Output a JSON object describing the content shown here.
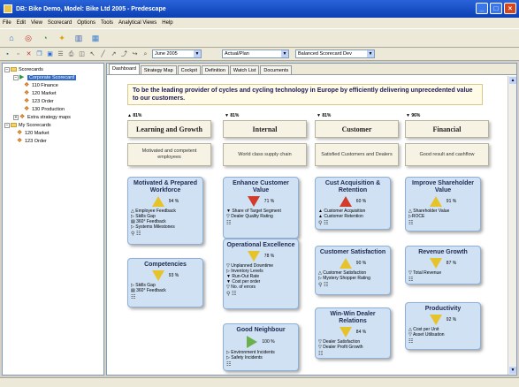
{
  "window": {
    "title": "DB: Bike Demo, Model: Bike Ltd 2005 - Predescape"
  },
  "menu": [
    "File",
    "Edit",
    "View",
    "Scorecard",
    "Options",
    "Tools",
    "Analytical Views",
    "Help"
  ],
  "toolbar2": {
    "period": "June 2005",
    "view": "Actual/Plan",
    "scorecard": "Balanced Scorecard Dev"
  },
  "tree": [
    {
      "label": "Scorecards",
      "level": 0,
      "type": "folder",
      "exp": "−"
    },
    {
      "label": "Corporate Scorecard",
      "level": 1,
      "type": "scorecard",
      "exp": "−",
      "selected": true
    },
    {
      "label": "110 Finance",
      "level": 2,
      "type": "scorecard"
    },
    {
      "label": "120 Market",
      "level": 2,
      "type": "scorecard"
    },
    {
      "label": "123 Order",
      "level": 2,
      "type": "scorecard"
    },
    {
      "label": "130 Production",
      "level": 2,
      "type": "scorecard"
    },
    {
      "label": "Extra strategy maps",
      "level": 1,
      "type": "scorecard",
      "exp": "+"
    },
    {
      "label": "My Scorecards",
      "level": 0,
      "type": "folder",
      "exp": "−"
    },
    {
      "label": "120 Market",
      "level": 1,
      "type": "scorecard"
    },
    {
      "label": "123 Order",
      "level": 1,
      "type": "scorecard"
    }
  ],
  "tabs": [
    "Dashboard",
    "Strategy Map",
    "Cockpit",
    "Definition",
    "Watch List",
    "Documents"
  ],
  "mission": "To be the leading provider of cycles and cycling technology in Europe by efficiently delivering unprecedented value to our customers.",
  "perspectives": [
    {
      "name": "Learning and Growth",
      "tag": "▲ 81%",
      "goal": "Motivated and competent employees"
    },
    {
      "name": "Internal",
      "tag": "▼ 81%",
      "goal": "World class supply chain"
    },
    {
      "name": "Customer",
      "tag": "▼ 81%",
      "goal": "Satisfied Customers and Dealers"
    },
    {
      "name": "Financial",
      "tag": "▼ 96%",
      "goal": "Good result and cashflow"
    }
  ],
  "objectives": {
    "motivated": {
      "title": "Motivated & Prepared Workforce",
      "pct": "94 %",
      "measures": [
        "△ Employee Feedback",
        "▷ Skills Gap",
        "▤ 360° Feedback",
        "▷ Systems Milestones"
      ]
    },
    "competencies": {
      "title": "Competencies",
      "pct": "93 %",
      "measures": [
        "▷ Skills Gap",
        "▤ 360° Feedback"
      ]
    },
    "enhance": {
      "title": "Enhance Customer Value",
      "pct": "71 %",
      "measures": [
        "▼ Share of Target Segment",
        "▽ Dealer Quality Rating"
      ]
    },
    "excellence": {
      "title": "Operational Excellence",
      "pct": "78 %",
      "measures": [
        "▽ Unplanned Downtime",
        "▷ Inventory Levels",
        "▼ Run-Out Rate",
        "▼ Cost per order",
        "▽ No. of errors"
      ]
    },
    "neighbour": {
      "title": "Good Neighbour",
      "pct": "100 %",
      "measures": [
        "▷ Environment Incidents",
        "▷ Safety Incidents"
      ]
    },
    "acquisition": {
      "title": "Cust Acquisition & Retention",
      "pct": "60 %",
      "measures": [
        "▲ Customer Acquisition",
        "▲ Customer Retention"
      ]
    },
    "satisfaction": {
      "title": "Customer Satisfaction",
      "pct": "90 %",
      "measures": [
        "△ Customer Satisfaction",
        "▷ Mystery Shopper Rating"
      ]
    },
    "winwin": {
      "title": "Win-Win Dealer Relations",
      "pct": "84 %",
      "measures": [
        "▽ Dealer Satisfaction",
        "▽ Dealer Profit Growth"
      ]
    },
    "shareholder": {
      "title": "Improve Shareholder Value",
      "pct": "91 %",
      "measures": [
        "△ Shareholder Value",
        "▷ROCE"
      ]
    },
    "revenue": {
      "title": "Revenue Growth",
      "pct": "87 %",
      "measures": [
        "▽ Total Revenue"
      ]
    },
    "productivity": {
      "title": "Productivity",
      "pct": "92 %",
      "measures": [
        "△ Cost per Unit",
        "▽ Asset Utilisation"
      ]
    }
  },
  "colors": {
    "objective_bg": "#cfe1f3",
    "yellow": "#e6c32a",
    "red": "#d23a2a",
    "green": "#6ab04c"
  }
}
